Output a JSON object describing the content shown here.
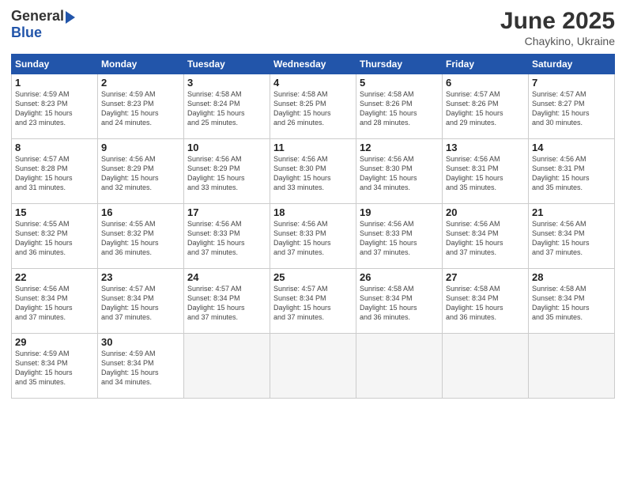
{
  "header": {
    "logo_general": "General",
    "logo_blue": "Blue",
    "month_year": "June 2025",
    "location": "Chaykino, Ukraine"
  },
  "weekdays": [
    "Sunday",
    "Monday",
    "Tuesday",
    "Wednesday",
    "Thursday",
    "Friday",
    "Saturday"
  ],
  "weeks": [
    [
      {
        "day": "1",
        "info": "Sunrise: 4:59 AM\nSunset: 8:23 PM\nDaylight: 15 hours\nand 23 minutes."
      },
      {
        "day": "2",
        "info": "Sunrise: 4:59 AM\nSunset: 8:23 PM\nDaylight: 15 hours\nand 24 minutes."
      },
      {
        "day": "3",
        "info": "Sunrise: 4:58 AM\nSunset: 8:24 PM\nDaylight: 15 hours\nand 25 minutes."
      },
      {
        "day": "4",
        "info": "Sunrise: 4:58 AM\nSunset: 8:25 PM\nDaylight: 15 hours\nand 26 minutes."
      },
      {
        "day": "5",
        "info": "Sunrise: 4:58 AM\nSunset: 8:26 PM\nDaylight: 15 hours\nand 28 minutes."
      },
      {
        "day": "6",
        "info": "Sunrise: 4:57 AM\nSunset: 8:26 PM\nDaylight: 15 hours\nand 29 minutes."
      },
      {
        "day": "7",
        "info": "Sunrise: 4:57 AM\nSunset: 8:27 PM\nDaylight: 15 hours\nand 30 minutes."
      }
    ],
    [
      {
        "day": "8",
        "info": "Sunrise: 4:57 AM\nSunset: 8:28 PM\nDaylight: 15 hours\nand 31 minutes."
      },
      {
        "day": "9",
        "info": "Sunrise: 4:56 AM\nSunset: 8:29 PM\nDaylight: 15 hours\nand 32 minutes."
      },
      {
        "day": "10",
        "info": "Sunrise: 4:56 AM\nSunset: 8:29 PM\nDaylight: 15 hours\nand 33 minutes."
      },
      {
        "day": "11",
        "info": "Sunrise: 4:56 AM\nSunset: 8:30 PM\nDaylight: 15 hours\nand 33 minutes."
      },
      {
        "day": "12",
        "info": "Sunrise: 4:56 AM\nSunset: 8:30 PM\nDaylight: 15 hours\nand 34 minutes."
      },
      {
        "day": "13",
        "info": "Sunrise: 4:56 AM\nSunset: 8:31 PM\nDaylight: 15 hours\nand 35 minutes."
      },
      {
        "day": "14",
        "info": "Sunrise: 4:56 AM\nSunset: 8:31 PM\nDaylight: 15 hours\nand 35 minutes."
      }
    ],
    [
      {
        "day": "15",
        "info": "Sunrise: 4:55 AM\nSunset: 8:32 PM\nDaylight: 15 hours\nand 36 minutes."
      },
      {
        "day": "16",
        "info": "Sunrise: 4:55 AM\nSunset: 8:32 PM\nDaylight: 15 hours\nand 36 minutes."
      },
      {
        "day": "17",
        "info": "Sunrise: 4:56 AM\nSunset: 8:33 PM\nDaylight: 15 hours\nand 37 minutes."
      },
      {
        "day": "18",
        "info": "Sunrise: 4:56 AM\nSunset: 8:33 PM\nDaylight: 15 hours\nand 37 minutes."
      },
      {
        "day": "19",
        "info": "Sunrise: 4:56 AM\nSunset: 8:33 PM\nDaylight: 15 hours\nand 37 minutes."
      },
      {
        "day": "20",
        "info": "Sunrise: 4:56 AM\nSunset: 8:34 PM\nDaylight: 15 hours\nand 37 minutes."
      },
      {
        "day": "21",
        "info": "Sunrise: 4:56 AM\nSunset: 8:34 PM\nDaylight: 15 hours\nand 37 minutes."
      }
    ],
    [
      {
        "day": "22",
        "info": "Sunrise: 4:56 AM\nSunset: 8:34 PM\nDaylight: 15 hours\nand 37 minutes."
      },
      {
        "day": "23",
        "info": "Sunrise: 4:57 AM\nSunset: 8:34 PM\nDaylight: 15 hours\nand 37 minutes."
      },
      {
        "day": "24",
        "info": "Sunrise: 4:57 AM\nSunset: 8:34 PM\nDaylight: 15 hours\nand 37 minutes."
      },
      {
        "day": "25",
        "info": "Sunrise: 4:57 AM\nSunset: 8:34 PM\nDaylight: 15 hours\nand 37 minutes."
      },
      {
        "day": "26",
        "info": "Sunrise: 4:58 AM\nSunset: 8:34 PM\nDaylight: 15 hours\nand 36 minutes."
      },
      {
        "day": "27",
        "info": "Sunrise: 4:58 AM\nSunset: 8:34 PM\nDaylight: 15 hours\nand 36 minutes."
      },
      {
        "day": "28",
        "info": "Sunrise: 4:58 AM\nSunset: 8:34 PM\nDaylight: 15 hours\nand 35 minutes."
      }
    ],
    [
      {
        "day": "29",
        "info": "Sunrise: 4:59 AM\nSunset: 8:34 PM\nDaylight: 15 hours\nand 35 minutes."
      },
      {
        "day": "30",
        "info": "Sunrise: 4:59 AM\nSunset: 8:34 PM\nDaylight: 15 hours\nand 34 minutes."
      },
      null,
      null,
      null,
      null,
      null
    ]
  ]
}
